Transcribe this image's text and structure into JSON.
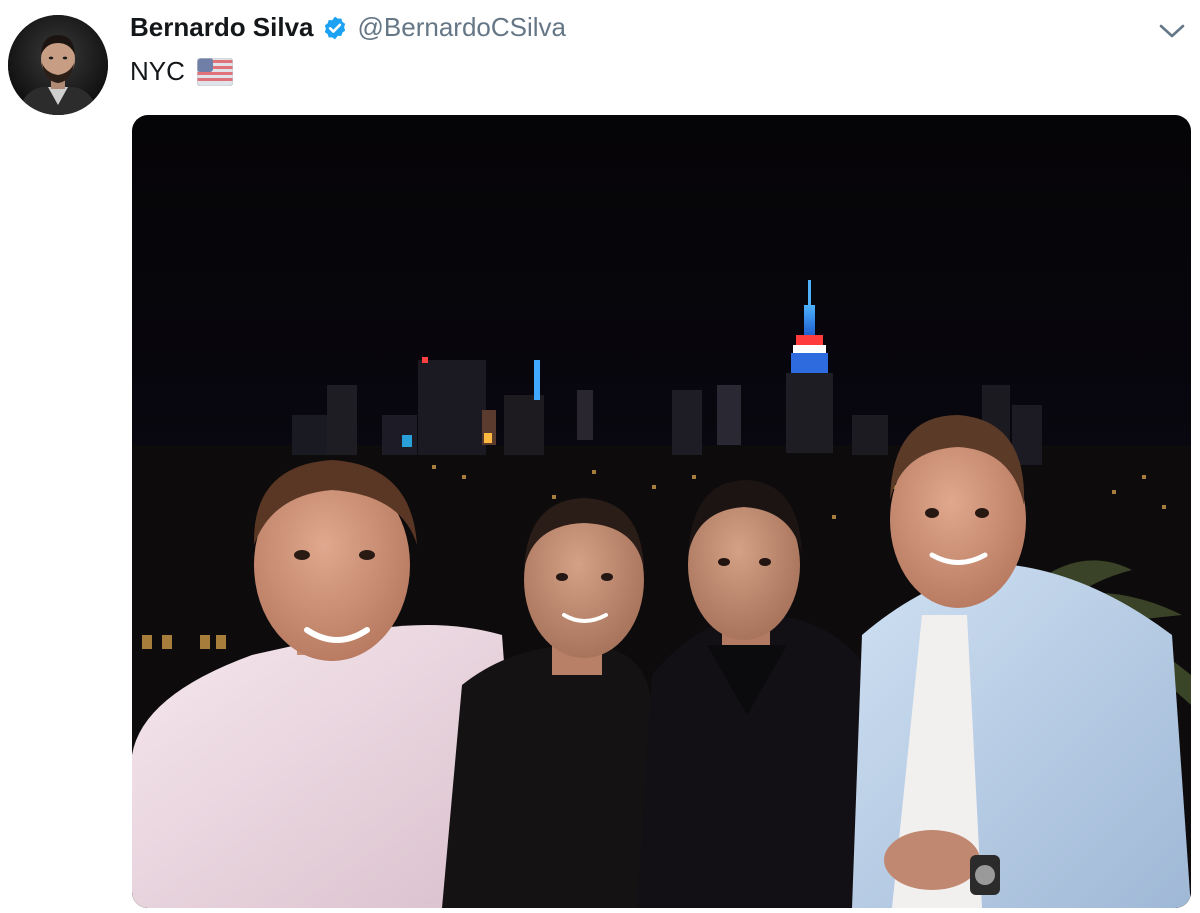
{
  "tweet": {
    "author": {
      "display_name": "Bernardo Silva",
      "handle": "@BernardoCSilva",
      "verified": true,
      "verified_color": "#1da1f2"
    },
    "text": "NYC",
    "emoji": "us-flag",
    "icons": {
      "caret": "chevron-down-icon",
      "verified": "verified-badge-icon"
    },
    "media": {
      "type": "photo"
    }
  },
  "colors": {
    "name": "#14171a",
    "handle": "#657786",
    "caret": "#657786",
    "accent": "#1da1f2"
  }
}
